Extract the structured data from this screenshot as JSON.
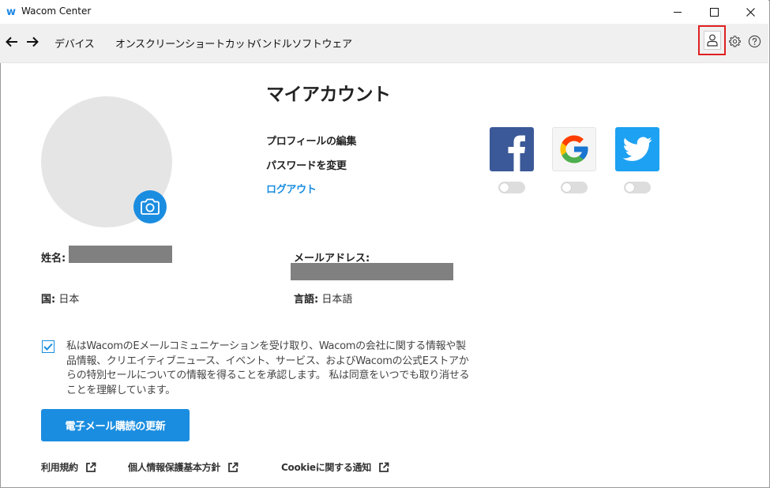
{
  "window": {
    "title": "Wacom Center",
    "logo_glyph": "w",
    "controls": [
      "minimize",
      "maximize",
      "close"
    ]
  },
  "nav": {
    "back_glyph": "←",
    "forward_glyph": "→",
    "items": [
      {
        "label": "デバイス"
      },
      {
        "label": "オンスクリーンショートカット"
      },
      {
        "label": "バンドルソフトウェア"
      }
    ],
    "right_icons": [
      "user-icon",
      "gear-icon",
      "help-icon"
    ]
  },
  "account": {
    "title": "マイアカウント",
    "links": {
      "edit_profile": "プロフィールの編集",
      "change_password": "パスワードを変更",
      "logout": "ログアウト"
    },
    "social": [
      {
        "name": "facebook",
        "icon": "facebook-icon",
        "connected": false
      },
      {
        "name": "google",
        "icon": "google-icon",
        "connected": false
      },
      {
        "name": "twitter",
        "icon": "twitter-icon",
        "connected": false
      }
    ],
    "fields": {
      "name_label": "姓名:",
      "email_label": "メールアドレス:",
      "country_label": "国:",
      "country_value": " 日本",
      "language_label": "言語:",
      "language_value": " 日本語"
    },
    "consent": {
      "checked": true,
      "text": "私はWacomのEメールコミュニケーションを受け取り、Wacomの会社に関する情報や製品情報、クリエイティブニュース、イベント、サービス、およびWacomの公式Eストアからの特別セールについての情報を得ることを承認します。 私は同意をいつでも取り消せることを理解しています。"
    },
    "update_button": "電子メール購読の更新",
    "footer_links": [
      {
        "label": "利用規約"
      },
      {
        "label": "個人情報保護基本方針"
      },
      {
        "label": "Cookieに関する通知"
      }
    ]
  },
  "colors": {
    "accent": "#1a8de0",
    "highlight": "#e02020",
    "facebook": "#3b5998",
    "twitter": "#1da1f2"
  }
}
